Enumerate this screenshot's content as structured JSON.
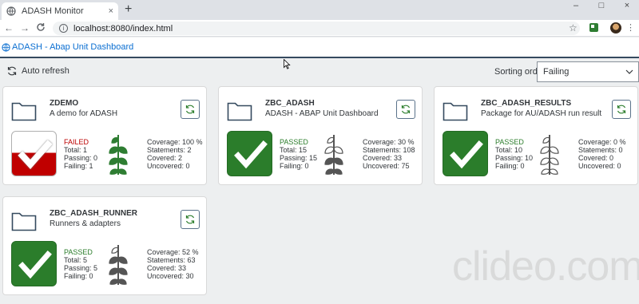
{
  "browser": {
    "tab_title": "ADASH Monitor",
    "tab_close": "×",
    "new_tab": "+",
    "win_min": "–",
    "win_max": "□",
    "win_close": "×",
    "back": "←",
    "forward": "→",
    "reload": "C",
    "home": "⌂",
    "url": "localhost:8080/index.html",
    "bookmark_star": "☆",
    "menu": "⋮"
  },
  "app": {
    "title": "ADASH - Abap Unit Dashboard",
    "auto_refresh_label": "Auto refresh",
    "sorting_label": "Sorting order",
    "sorting_value": "Failing"
  },
  "cards": [
    {
      "name": "ZDEMO",
      "description": "A demo for ADASH",
      "status": "FAILED",
      "total": "Total: 1",
      "passing": "Passing: 0",
      "failing": "Failing: 1",
      "coverage": "Coverage: 100 %",
      "statements": "Statements: 2",
      "covered": "Covered: 2",
      "uncovered": "Uncovered: 0",
      "coverage_pct": 100
    },
    {
      "name": "ZBC_ADASH",
      "description": "ADASH - ABAP Unit Dashboard",
      "status": "PASSED",
      "total": "Total: 15",
      "passing": "Passing: 15",
      "failing": "Failing: 0",
      "coverage": "Coverage: 30 %",
      "statements": "Statements: 108",
      "covered": "Covered: 33",
      "uncovered": "Uncovered: 75",
      "coverage_pct": 30
    },
    {
      "name": "ZBC_ADASH_RESULTS",
      "description": "Package for AU/ADASH run result",
      "status": "PASSED",
      "total": "Total: 10",
      "passing": "Passing: 10",
      "failing": "Failing: 0",
      "coverage": "Coverage: 0 %",
      "statements": "Statements: 0",
      "covered": "Covered: 0",
      "uncovered": "Uncovered: 0",
      "coverage_pct": 0
    },
    {
      "name": "ZBC_ADASH_RUNNER",
      "description": "Runners & adapters",
      "status": "PASSED",
      "total": "Total: 5",
      "passing": "Passing: 5",
      "failing": "Failing: 0",
      "coverage": "Coverage: 52 %",
      "statements": "Statements: 63",
      "covered": "Covered: 33",
      "uncovered": "Uncovered: 30",
      "coverage_pct": 52
    }
  ],
  "watermark": "clideo.com",
  "colors": {
    "passed": "#2b7d2b",
    "failed": "#c00000",
    "leaf_full": "#2e7d32",
    "leaf_partial": "#555555",
    "accent": "#0a6ed1",
    "shellbar_border": "#354a5f"
  }
}
